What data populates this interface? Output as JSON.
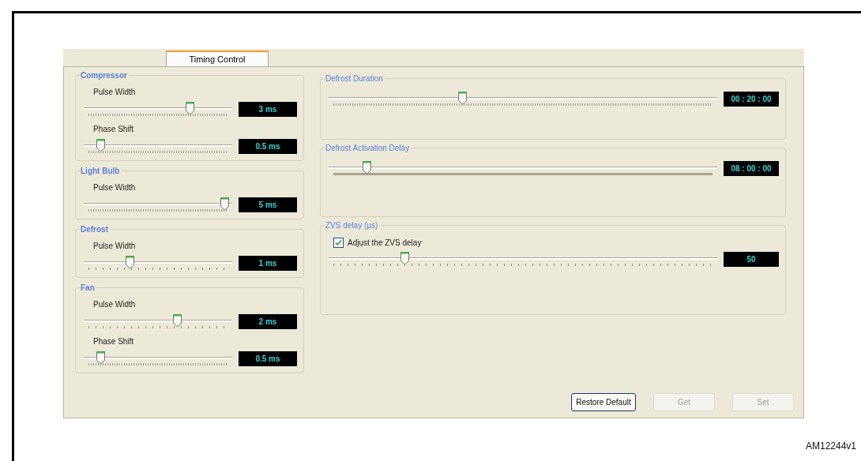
{
  "tabs": [
    {
      "label": "Timing Control",
      "selected": true
    }
  ],
  "left_groups": [
    {
      "title": "Compressor",
      "sliders": [
        {
          "label": "Pulse Width",
          "level": 0.73,
          "reading": "3 ms",
          "kind": "dotted"
        },
        {
          "label": "Phase Shift",
          "level": 0.09,
          "reading": "0.5 ms",
          "kind": "dotted"
        }
      ]
    },
    {
      "title": "Light Bulb",
      "sliders": [
        {
          "label": "Pulse Width",
          "level": 0.98,
          "reading": "5 ms",
          "kind": "dotted"
        }
      ]
    },
    {
      "title": "Defrost",
      "sliders": [
        {
          "label": "Pulse Width",
          "level": 0.3,
          "reading": "1 ms",
          "kind": "spaced"
        }
      ]
    },
    {
      "title": "Fan",
      "sliders": [
        {
          "label": "Pulse Width",
          "level": 0.64,
          "reading": "2 ms",
          "kind": "spaced"
        },
        {
          "label": "Phase Shift",
          "level": 0.09,
          "reading": "0.5 ms",
          "kind": "dotted"
        }
      ]
    }
  ],
  "right_groups": [
    {
      "title": "Defrost Duration",
      "slider": {
        "level": 0.34,
        "reading": "00 : 20 : 00",
        "kind": "dotted"
      }
    },
    {
      "title": "Defrost Activation Delay",
      "slider": {
        "level": 0.09,
        "reading": "08 : 00 : 00",
        "kind": "bar"
      }
    },
    {
      "title": "ZVS delay (µs)",
      "checkbox": {
        "label": "Adjust the ZVS delay",
        "checked": true
      },
      "slider": {
        "level": 0.19,
        "reading": "50",
        "kind": "spaced"
      }
    }
  ],
  "buttons": [
    {
      "label": "Restore Default",
      "disabled": false
    },
    {
      "label": "Get",
      "disabled": true
    },
    {
      "label": "Set",
      "disabled": true
    }
  ],
  "figure_id": "AM12244v1"
}
